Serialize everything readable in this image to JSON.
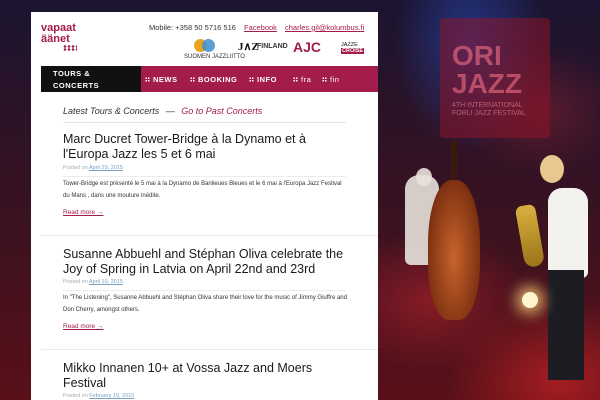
{
  "logo": {
    "line1": "vapaat",
    "line2": "äänet"
  },
  "contact": {
    "mobile": "Mobile: +358 50 5716 516",
    "facebook": "Facebook",
    "email": "charles.gil@kolumbus.fi"
  },
  "partners": {
    "suomi_jazz": "SUOMEN JAZZLIITTO",
    "jazz_finland_mark": "J∧Z",
    "jazz_finland": "FINLAND",
    "ajc": "AJC",
    "jazz_croise_1": "JAZZE",
    "jazz_croise_2": "CROISE"
  },
  "colors": {
    "accent": "#a31c4b",
    "nav_active": "#111111",
    "panel": "#ffffff"
  },
  "nav": {
    "active_line1": "TOURS &",
    "active_line2": "CONCERTS",
    "items": [
      {
        "label": "NEWS"
      },
      {
        "label": "BOOKING"
      },
      {
        "label": "INFO"
      },
      {
        "label": "fra"
      },
      {
        "label": "fin"
      }
    ]
  },
  "section": {
    "latest": "Latest Tours & Concerts",
    "dash": "—",
    "past": "Go to Past Concerts"
  },
  "posts": [
    {
      "title": "Marc Ducret Tower-Bridge à la Dynamo et à l'Europa Jazz les 5 et 6 mai",
      "meta_prefix": "Posted on ",
      "date": "April 29, 2015",
      "excerpt": "Tower-Bridge est présenté le 5 mai à la Dynamo de Banlieues Bleues et le 6 mai à l'Europa Jazz Festival du Mans , dans une mouture inédite.",
      "read_more": "Read more →"
    },
    {
      "title": "Susanne Abbuehl and Stéphan Oliva celebrate the Joy of Spring in Latvia on April 22nd and 23rd",
      "meta_prefix": "Posted on ",
      "date": "April 10, 2015",
      "excerpt": "In \"The Listening\", Susanne Abbuehl and Stéphan Oliva share their love for the music of Jimmy Giuffre and Don Cherry, amongst others.",
      "read_more": "Read more →"
    },
    {
      "title": "Mikko Innanen 10+ at Vossa Jazz and Moers Festival",
      "meta_prefix": "Posted on ",
      "date": "February 19, 2015"
    }
  ],
  "background": {
    "banner_line1": "ORI",
    "banner_line2": "JAZZ",
    "banner_sub": "4TH INTERNATIONAL FORLI JAZZ FESTIVAL"
  }
}
